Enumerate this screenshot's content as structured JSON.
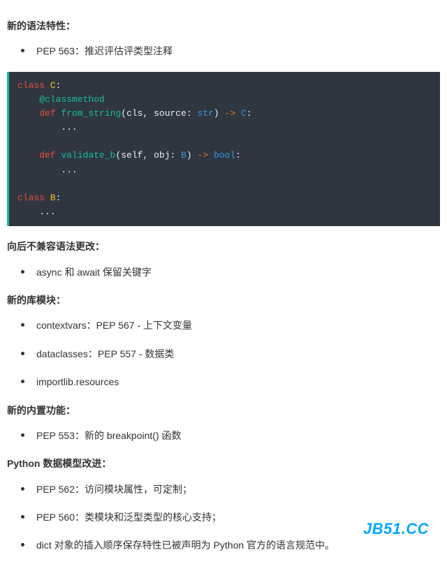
{
  "sections": {
    "syntax_features": {
      "title": "新的语法特性：",
      "items": [
        "PEP 563：推迟评估评类型注释"
      ]
    },
    "code": {
      "t": {
        "class_kw": "class",
        "C": "C",
        "colon": ":",
        "classmethod": "@classmethod",
        "def_kw": "def",
        "from_string": "from_string",
        "lp": "(",
        "rp": ")",
        "cls": "cls",
        "comma": ", ",
        "source": "source",
        "ann": ": ",
        "str": "str",
        "arrow": " -> ",
        "C2": "C",
        "dots": "...",
        "validate_b": "validate_b",
        "self": "self",
        "obj": "obj",
        "Btype": "B",
        "bool": "bool",
        "B": "B"
      }
    },
    "backward": {
      "title": "向后不兼容语法更改：",
      "items": [
        "async 和 await 保留关键字"
      ]
    },
    "new_libs": {
      "title": "新的库模块：",
      "items": [
        "contextvars：PEP 567 - 上下文变量",
        "dataclasses：PEP 557 - 数据类",
        "importlib.resources"
      ]
    },
    "builtins": {
      "title": "新的内置功能：",
      "items": [
        "PEP 553：新的 breakpoint() 函数"
      ]
    },
    "datamodel": {
      "title": "Python 数据模型改进：",
      "items": [
        "PEP 562：访问模块属性，可定制；",
        "PEP 560：类模块和泛型类型的核心支持；",
        "dict 对象的插入顺序保存特性已被声明为 Python 官方的语言规范中。"
      ]
    }
  },
  "watermark": "JB51.CC"
}
